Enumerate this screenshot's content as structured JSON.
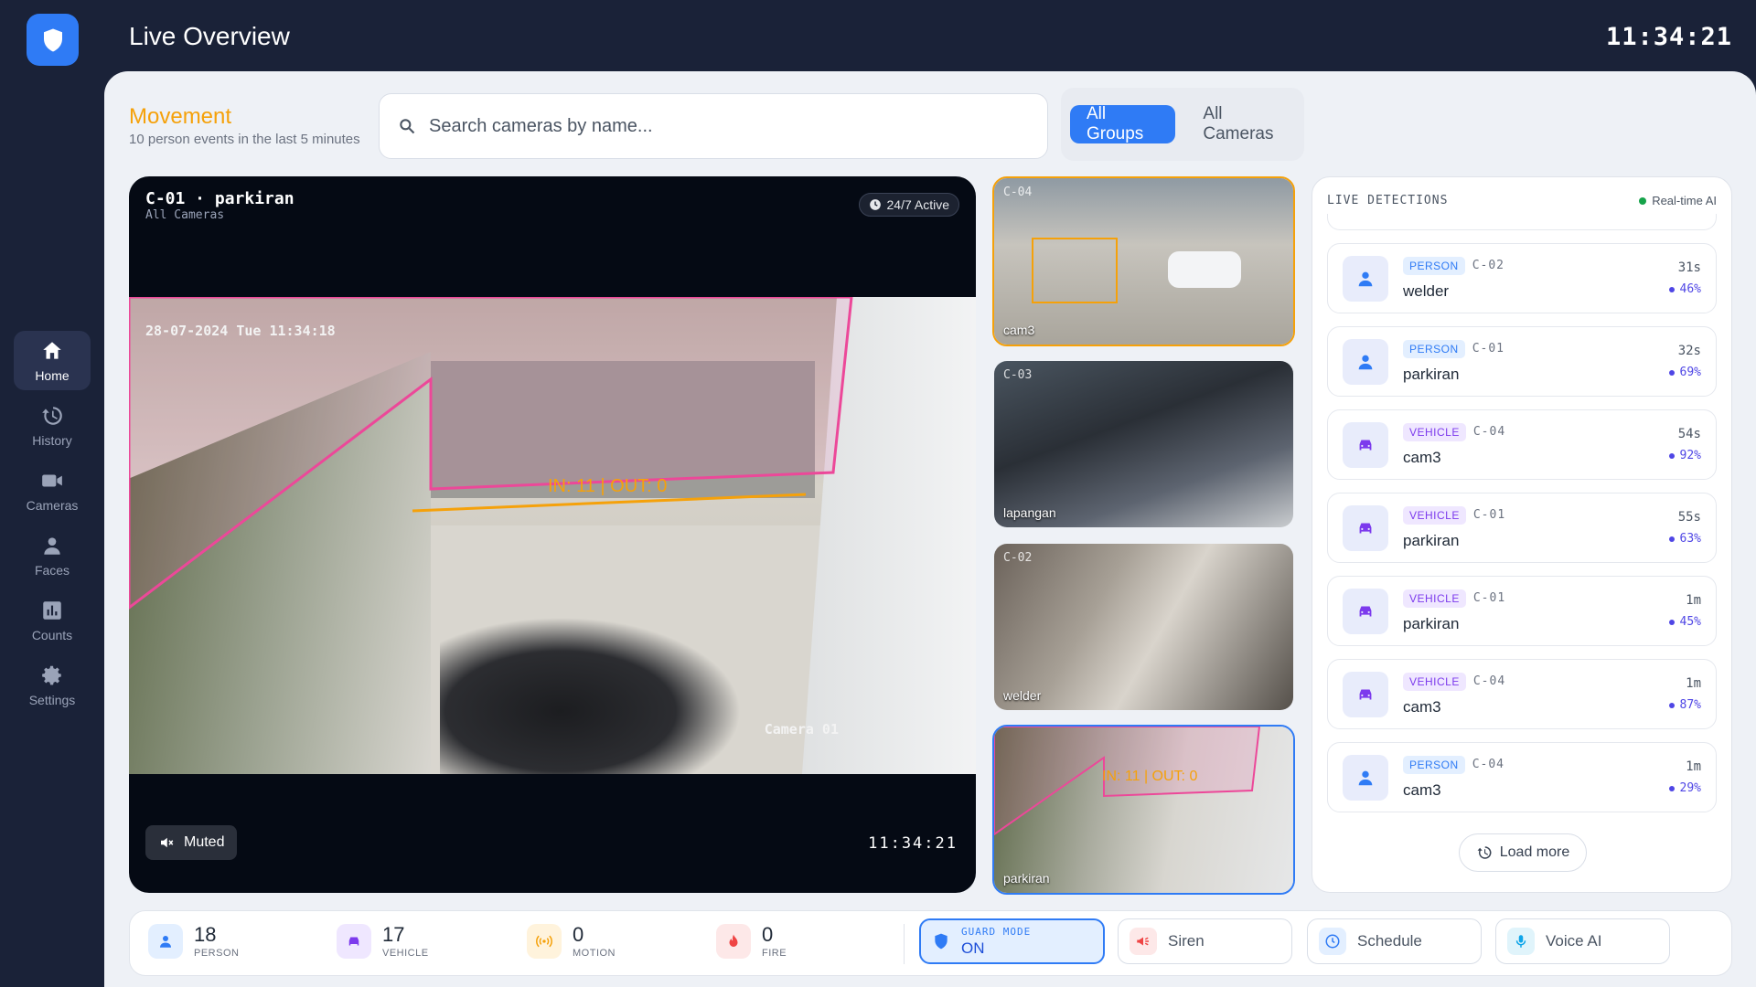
{
  "app": {
    "title": "Live Overview",
    "clock": "11:34:21"
  },
  "sidebar": {
    "items": [
      {
        "label": "Home",
        "icon": "home-icon",
        "active": true
      },
      {
        "label": "History",
        "icon": "history-icon",
        "active": false
      },
      {
        "label": "Cameras",
        "icon": "camera-icon",
        "active": false
      },
      {
        "label": "Faces",
        "icon": "person-icon",
        "active": false
      },
      {
        "label": "Counts",
        "icon": "bar-chart-icon",
        "active": false
      },
      {
        "label": "Settings",
        "icon": "gear-icon",
        "active": false
      }
    ]
  },
  "movement": {
    "title": "Movement",
    "subtitle": "10 person events in the last 5 minutes"
  },
  "search": {
    "placeholder": "Search cameras by name..."
  },
  "groups": {
    "all_groups": "All Groups",
    "all_cameras": "All Cameras",
    "selected": "All Groups"
  },
  "main_camera": {
    "title": "C-01 · parkiran",
    "subtitle": "All Cameras",
    "badge": "24/7 Active",
    "overlay_timestamp": "28-07-2024 Tue 11:34:18",
    "overlay_camera": "Camera 01",
    "counter": "IN: 11 | OUT: 0",
    "muted_label": "Muted",
    "time": "11:34:21"
  },
  "thumbnails": [
    {
      "id": "C-04",
      "label": "cam3",
      "selected": "orange"
    },
    {
      "id": "C-03",
      "label": "lapangan",
      "selected": ""
    },
    {
      "id": "C-02",
      "label": "welder",
      "selected": ""
    },
    {
      "id": "C-01",
      "label": "parkiran",
      "selected": "blue",
      "counter": "IN: 11 | OUT: 0"
    }
  ],
  "detections": {
    "title": "LIVE DETECTIONS",
    "realtime": "Real-time AI",
    "items": [
      {
        "type": "PERSON",
        "camera": "C-02",
        "name": "welder",
        "age": "31s",
        "confidence": "46%"
      },
      {
        "type": "PERSON",
        "camera": "C-01",
        "name": "parkiran",
        "age": "32s",
        "confidence": "69%"
      },
      {
        "type": "VEHICLE",
        "camera": "C-04",
        "name": "cam3",
        "age": "54s",
        "confidence": "92%"
      },
      {
        "type": "VEHICLE",
        "camera": "C-01",
        "name": "parkiran",
        "age": "55s",
        "confidence": "63%"
      },
      {
        "type": "VEHICLE",
        "camera": "C-01",
        "name": "parkiran",
        "age": "1m",
        "confidence": "45%"
      },
      {
        "type": "VEHICLE",
        "camera": "C-04",
        "name": "cam3",
        "age": "1m",
        "confidence": "87%"
      },
      {
        "type": "PERSON",
        "camera": "C-04",
        "name": "cam3",
        "age": "1m",
        "confidence": "29%"
      }
    ],
    "load_more": "Load more"
  },
  "stats": {
    "person": {
      "value": "18",
      "label": "PERSON"
    },
    "vehicle": {
      "value": "17",
      "label": "VEHICLE"
    },
    "motion": {
      "value": "0",
      "label": "MOTION"
    },
    "fire": {
      "value": "0",
      "label": "FIRE"
    }
  },
  "controls": {
    "guard_label": "GUARD MODE",
    "guard_value": "ON",
    "siren": "Siren",
    "schedule": "Schedule",
    "voice": "Voice AI"
  },
  "colors": {
    "accent": "#2f7bf5",
    "movement": "#f5a10a",
    "sidebar_bg": "#1a2238",
    "person": "#2f7bf5",
    "vehicle": "#7c3aed",
    "fire": "#ef4444"
  }
}
